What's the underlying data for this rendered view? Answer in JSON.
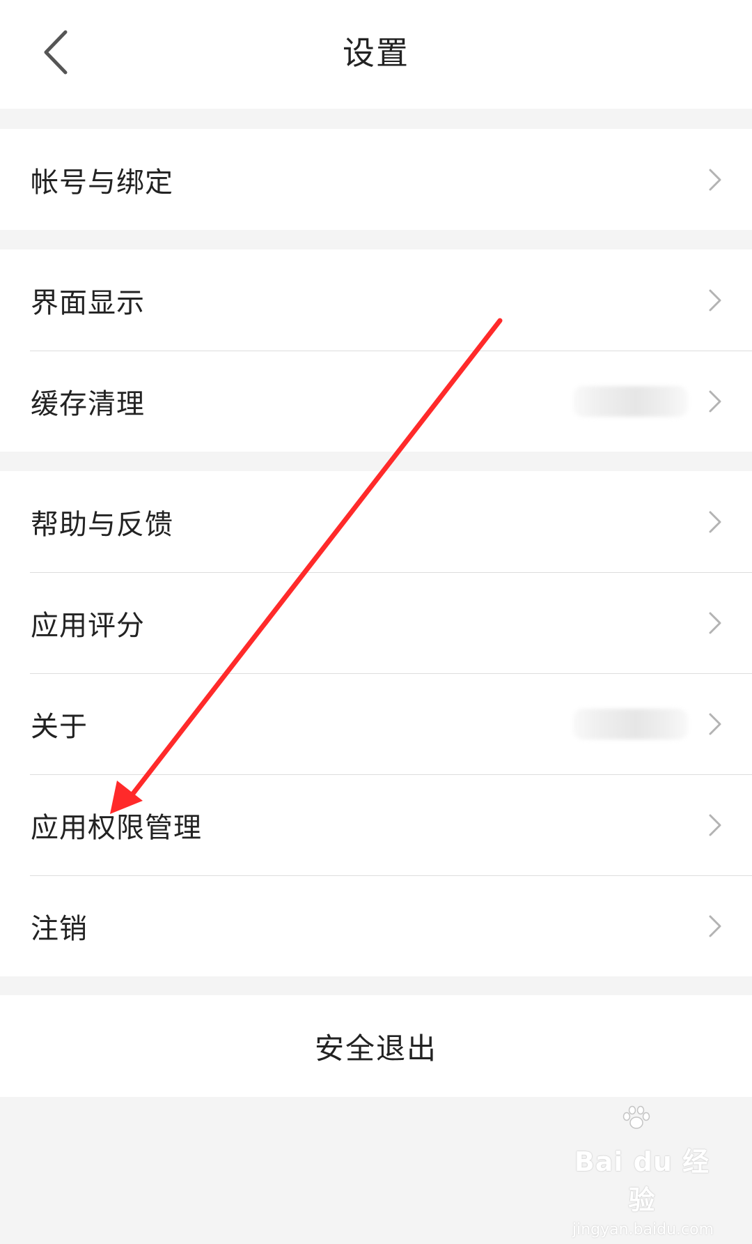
{
  "header": {
    "title": "设置",
    "back_icon": "chevron-left-icon"
  },
  "groups": [
    {
      "items": [
        {
          "label": "帐号与绑定"
        }
      ]
    },
    {
      "items": [
        {
          "label": "界面显示"
        },
        {
          "label": "缓存清理"
        }
      ]
    },
    {
      "items": [
        {
          "label": "帮助与反馈"
        },
        {
          "label": "应用评分"
        },
        {
          "label": "关于"
        },
        {
          "label": "应用权限管理"
        },
        {
          "label": "注销"
        }
      ]
    }
  ],
  "logout": {
    "label": "安全退出"
  },
  "annotation": {
    "arrow_color": "#ff2a2a",
    "points_to": "应用权限管理"
  },
  "watermark": {
    "main": "Bai du 经验",
    "sub": "jingyan.baidu.com"
  },
  "colors": {
    "background": "#f4f4f4",
    "surface": "#ffffff",
    "text": "#222222",
    "divider": "#dddddd",
    "chevron": "#b3b3b3"
  }
}
